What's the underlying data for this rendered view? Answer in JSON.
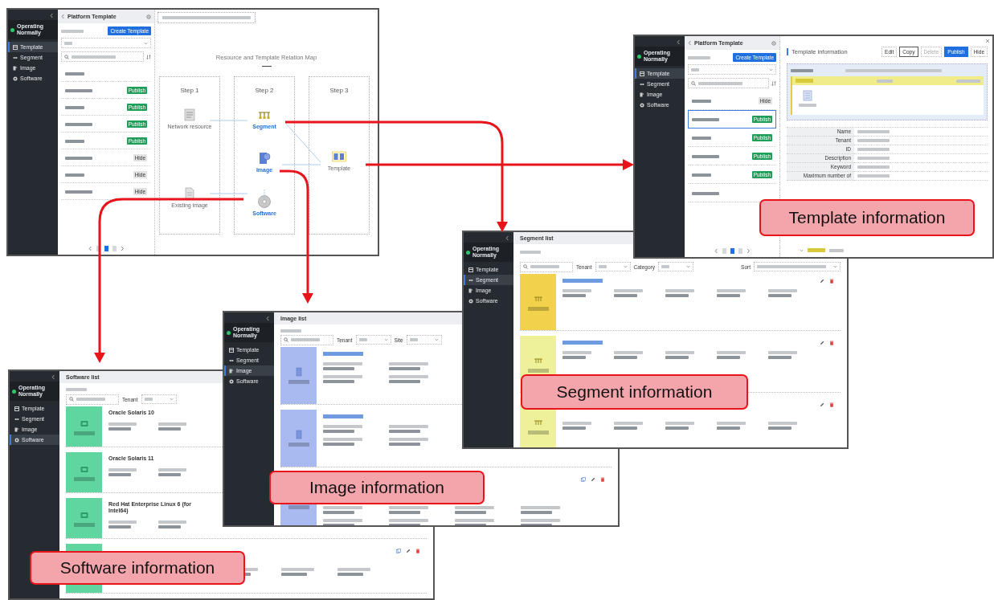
{
  "relation_map_window": {
    "sidebar": {
      "status": "Operating Normally",
      "items": [
        {
          "label": "Template",
          "selected": true
        },
        {
          "label": "Segment",
          "selected": false
        },
        {
          "label": "Image",
          "selected": false
        },
        {
          "label": "Software",
          "selected": false
        }
      ]
    },
    "panel": {
      "title": "Platform Template",
      "create_button": "Create Template",
      "templates": [
        {
          "selected": false
        },
        {
          "badge": "Publish",
          "published": true,
          "selected": false
        },
        {
          "badge": "Publish",
          "published": true,
          "selected": false
        },
        {
          "badge": "Publish",
          "published": true,
          "selected": false
        },
        {
          "badge": "Publish",
          "published": true,
          "selected": false
        },
        {
          "badge": "Hide",
          "published": false,
          "selected": false
        },
        {
          "badge": "Hide",
          "published": false,
          "selected": false
        },
        {
          "badge": "Hide",
          "published": false,
          "selected": false
        }
      ],
      "pages": [
        {
          "selected": false
        },
        {
          "selected": true
        },
        {
          "selected": false
        }
      ]
    },
    "map_title": "Resource and Template Relation Map",
    "steps": [
      {
        "label": "Step 1",
        "nodes": [
          {
            "kind": "network",
            "label": "Network resource"
          },
          {
            "kind": "disk",
            "label": "Existing image"
          }
        ]
      },
      {
        "label": "Step 2",
        "nodes": [
          {
            "kind": "segment",
            "label": "Segment"
          },
          {
            "kind": "image",
            "label": "Image"
          },
          {
            "kind": "software",
            "label": "Software"
          }
        ]
      },
      {
        "label": "Step 3",
        "nodes": [
          {
            "kind": "template",
            "label": "Template"
          }
        ]
      }
    ]
  },
  "template_info_window": {
    "sidebar": {
      "status": "Operating Normally",
      "items": [
        {
          "label": "Template",
          "selected": true
        },
        {
          "label": "Segment",
          "selected": false
        },
        {
          "label": "Image",
          "selected": false
        },
        {
          "label": "Software",
          "selected": false
        }
      ]
    },
    "panel": {
      "title": "Platform Template",
      "create_button": "Create Template",
      "templates": [
        {
          "badge": "Hide",
          "published": false,
          "selected": false
        },
        {
          "badge": "Publish",
          "published": true,
          "selected": true
        },
        {
          "badge": "Publish",
          "published": true,
          "selected": false
        },
        {
          "badge": "Publish",
          "published": true,
          "selected": false
        },
        {
          "badge": "Publish",
          "published": true,
          "selected": false
        },
        {
          "selected": false
        }
      ],
      "pages": [
        {
          "selected": false
        },
        {
          "selected": true
        },
        {
          "selected": false
        }
      ]
    },
    "title": "Template information",
    "actions": [
      {
        "label": "Edit",
        "kind": "default"
      },
      {
        "label": "Copy",
        "kind": "outlined"
      },
      {
        "label": "Delete",
        "kind": "disabled"
      },
      {
        "label": "Publish",
        "kind": "primary"
      },
      {
        "label": "Hide",
        "kind": "default"
      }
    ],
    "properties": [
      {
        "label": "Name"
      },
      {
        "label": "Tenant"
      },
      {
        "label": "ID"
      },
      {
        "label": "Description"
      },
      {
        "label": "Keyword"
      },
      {
        "label": "Maximum number of"
      }
    ]
  },
  "segment_window": {
    "kind": "segment",
    "sidebar": {
      "status": "Operating Normally",
      "items": [
        {
          "label": "Template",
          "selected": false
        },
        {
          "label": "Segment",
          "selected": true
        },
        {
          "label": "Image",
          "selected": false
        },
        {
          "label": "Software",
          "selected": false
        }
      ]
    },
    "title": "Segment list",
    "filters": [
      {
        "kind": "search"
      },
      {
        "kind": "select",
        "label": "Tenant"
      },
      {
        "kind": "select",
        "label": "Category"
      },
      {
        "kind": "sort",
        "label": "Sort"
      }
    ],
    "cards": [
      {
        "color": "#f2d24c",
        "editable": true,
        "named": true
      },
      {
        "color": "#eef09a",
        "editable": true,
        "named": true
      },
      {
        "color": "#eef09a",
        "editable": true,
        "named": false
      }
    ]
  },
  "image_window": {
    "kind": "image",
    "sidebar": {
      "status": "Operating Normally",
      "items": [
        {
          "label": "Template",
          "selected": false
        },
        {
          "label": "Segment",
          "selected": false
        },
        {
          "label": "Image",
          "selected": true
        },
        {
          "label": "Software",
          "selected": false
        }
      ]
    },
    "title": "Image list",
    "filters": [
      {
        "kind": "search"
      },
      {
        "kind": "select",
        "label": "Tenant"
      },
      {
        "kind": "select",
        "label": "Site"
      }
    ],
    "cards": [
      {
        "color": "#a9baf0",
        "editable": false,
        "named": true
      },
      {
        "color": "#a9baf0",
        "editable": false,
        "named": true
      },
      {
        "color": "#a9baf0",
        "editable": true,
        "named": false
      }
    ]
  },
  "software_window": {
    "kind": "software",
    "sidebar": {
      "status": "Operating Normally",
      "items": [
        {
          "label": "Template",
          "selected": false
        },
        {
          "label": "Segment",
          "selected": false
        },
        {
          "label": "Image",
          "selected": false
        },
        {
          "label": "Software",
          "selected": true
        }
      ]
    },
    "title": "Software list",
    "filters": [
      {
        "kind": "search"
      },
      {
        "kind": "select",
        "label": "Tenant"
      }
    ],
    "cards": [
      {
        "name": "Oracle Solaris 10",
        "color": "#5fd6a0",
        "editable": false
      },
      {
        "name": "Oracle Solaris 11",
        "color": "#5fd6a0",
        "editable": false
      },
      {
        "name": "Red Hat Enterprise Linux 6 (for Intel64)",
        "color": "#5fd6a0",
        "editable": false
      },
      {
        "color": "#5fd6a0",
        "editable": true
      }
    ]
  },
  "callouts": [
    {
      "label": "Template information"
    },
    {
      "label": "Segment information"
    },
    {
      "label": "Image information"
    },
    {
      "label": "Software information"
    }
  ]
}
